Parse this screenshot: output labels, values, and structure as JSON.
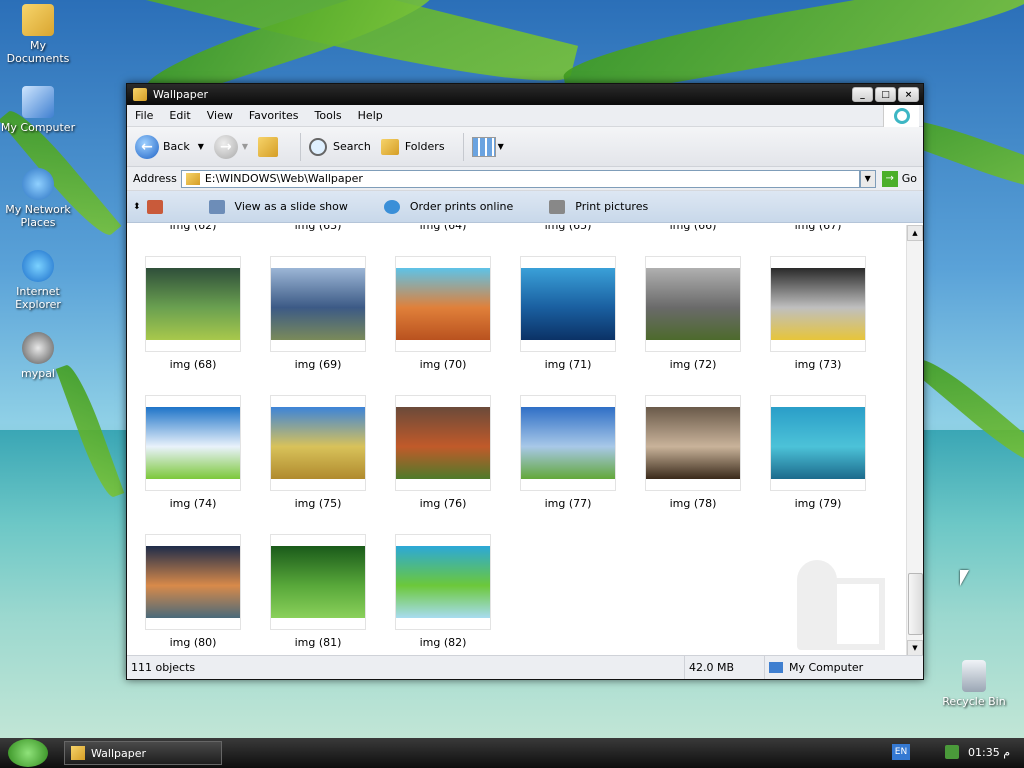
{
  "desktop": {
    "icons": [
      {
        "label": "My Documents"
      },
      {
        "label": "My Computer"
      },
      {
        "label": "My Network Places"
      },
      {
        "label": "Internet Explorer"
      },
      {
        "label": "mypal"
      },
      {
        "label": "Recycle Bin"
      }
    ]
  },
  "window": {
    "title": "Wallpaper",
    "controls": {
      "minimize": "_",
      "maximize": "□",
      "close": "×"
    },
    "menu": [
      "File",
      "Edit",
      "View",
      "Favorites",
      "Tools",
      "Help"
    ],
    "toolbar": {
      "back": "Back",
      "search": "Search",
      "folders": "Folders"
    },
    "address": {
      "label": "Address",
      "value": "E:\\WINDOWS\\Web\\Wallpaper",
      "go": "Go"
    },
    "tasks": [
      "View as a slide show",
      "Order prints online",
      "Print pictures"
    ],
    "partial_labels": [
      "img (62)",
      "img (63)",
      "img (64)",
      "img (65)",
      "img (66)",
      "img (67)"
    ],
    "thumbnails": [
      {
        "label": "img (68)",
        "colors": [
          "#2f4f3a",
          "#6aa050",
          "#a8c84c"
        ]
      },
      {
        "label": "img (69)",
        "colors": [
          "#9cb6d6",
          "#3c5a86",
          "#7a8a5a"
        ]
      },
      {
        "label": "img (70)",
        "colors": [
          "#5ec3e8",
          "#e0803a",
          "#b9521f"
        ]
      },
      {
        "label": "img (71)",
        "colors": [
          "#3aa0d8",
          "#1a5fa0",
          "#0b3266"
        ]
      },
      {
        "label": "img (72)",
        "colors": [
          "#b0b0b0",
          "#6a6a6a",
          "#4d6a2c"
        ]
      },
      {
        "label": "img (73)",
        "colors": [
          "#2a2a2a",
          "#bfbfbf",
          "#e7c53a"
        ]
      },
      {
        "label": "img (74)",
        "colors": [
          "#1e74c8",
          "#e9f2fb",
          "#7cc83a"
        ]
      },
      {
        "label": "img (75)",
        "colors": [
          "#3d84d8",
          "#d8c25a",
          "#b08a2e"
        ]
      },
      {
        "label": "img (76)",
        "colors": [
          "#6b4a3a",
          "#c15a2a",
          "#4e7a2a"
        ]
      },
      {
        "label": "img (77)",
        "colors": [
          "#2f6fc6",
          "#a8c8e8",
          "#62a83a"
        ]
      },
      {
        "label": "img (78)",
        "colors": [
          "#6a5a4a",
          "#c9b39a",
          "#3a2a1a"
        ]
      },
      {
        "label": "img (79)",
        "colors": [
          "#2a9ec8",
          "#4cc2d8",
          "#1c6a8c"
        ]
      },
      {
        "label": "img (80)",
        "colors": [
          "#1e2c4a",
          "#d88a4a",
          "#4a6a7a"
        ]
      },
      {
        "label": "img (81)",
        "colors": [
          "#1a5a1a",
          "#58a83a",
          "#8ad05a"
        ]
      },
      {
        "label": "img (82)",
        "colors": [
          "#2ca8d8",
          "#6cc83a",
          "#a8dcf0"
        ]
      }
    ],
    "status": {
      "objects": "111 objects",
      "size": "42.0 MB",
      "location": "My Computer"
    }
  },
  "taskbar": {
    "task": "Wallpaper",
    "lang": "EN",
    "clock": "01:35 م"
  },
  "colors": {
    "accent": "#1f63c6",
    "titlebar": "#0b0b0b",
    "tasks_bg": "#c8d8ea"
  }
}
